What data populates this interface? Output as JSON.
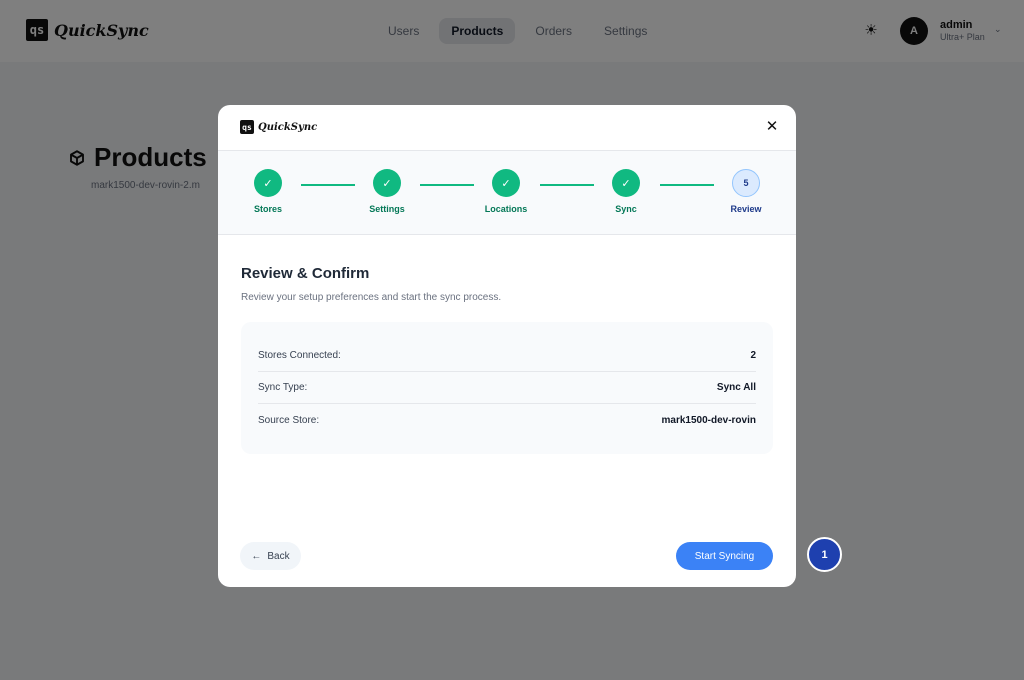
{
  "app": {
    "logo_mark": "qs",
    "name": "QuickSync"
  },
  "nav": {
    "items": [
      {
        "label": "Users"
      },
      {
        "label": "Products"
      },
      {
        "label": "Orders"
      },
      {
        "label": "Settings"
      }
    ],
    "active": "Products"
  },
  "user": {
    "initial": "A",
    "name": "admin",
    "plan": "Ultra+ Plan"
  },
  "page": {
    "title": "Products",
    "subtitle": "mark1500-dev-rovin-2.m"
  },
  "modal": {
    "logo_mark": "qs",
    "logo_name": "QuickSync",
    "close_symbol": "✕",
    "steps": [
      {
        "label": "Stores",
        "state": "done",
        "mark": "✓"
      },
      {
        "label": "Settings",
        "state": "done",
        "mark": "✓"
      },
      {
        "label": "Locations",
        "state": "done",
        "mark": "✓"
      },
      {
        "label": "Sync",
        "state": "done",
        "mark": "✓"
      },
      {
        "label": "Review",
        "state": "current",
        "mark": "5"
      }
    ],
    "title": "Review & Confirm",
    "description": "Review your setup preferences and start the sync process.",
    "summary": [
      {
        "label": "Stores Connected:",
        "value": "2"
      },
      {
        "label": "Sync Type:",
        "value": "Sync All"
      },
      {
        "label": "Source Store:",
        "value": "mark1500-dev-rovin"
      }
    ],
    "back_label": "Back",
    "back_icon": "←",
    "start_label": "Start Syncing"
  },
  "annotation": {
    "number": "1"
  },
  "colors": {
    "success": "#10b981",
    "primary": "#3b82f6",
    "annotation": "#1e40af"
  }
}
